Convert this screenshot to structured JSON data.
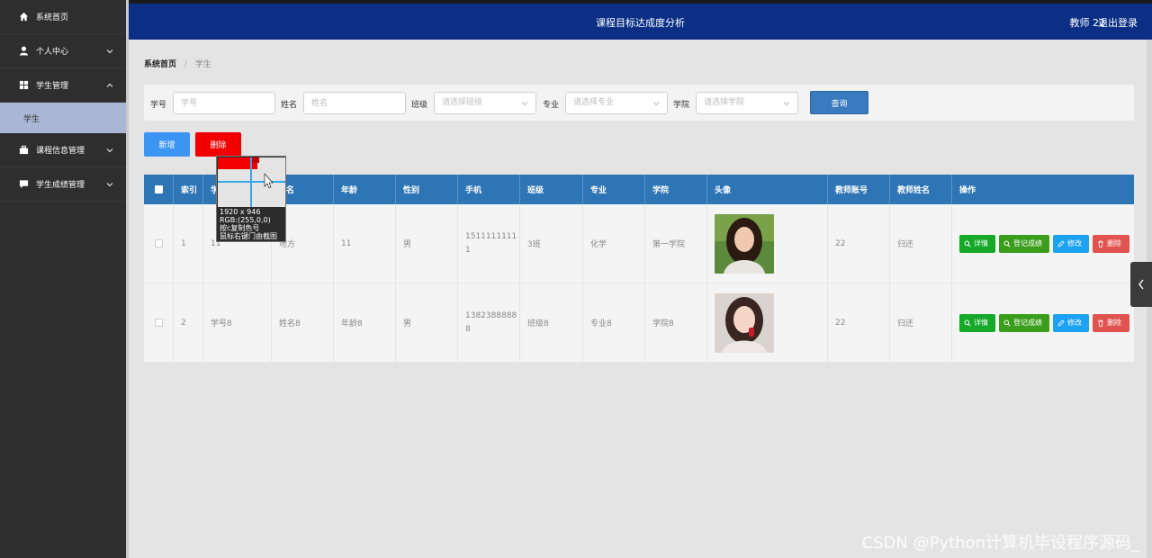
{
  "header": {
    "title": "课程目标达成度分析",
    "user": "教师 22",
    "logout": "退出登录"
  },
  "sidebar": {
    "items": [
      {
        "label": "系统首页",
        "icon": "home-icon"
      },
      {
        "label": "个人中心",
        "icon": "user-icon"
      },
      {
        "label": "学生管理",
        "icon": "grid-icon"
      },
      {
        "label": "学生",
        "sub": true
      },
      {
        "label": "课程信息管理",
        "icon": "briefcase-icon"
      },
      {
        "label": "学生成绩管理",
        "icon": "chat-icon"
      }
    ]
  },
  "breadcrumb": {
    "home": "系统首页",
    "separator": "/",
    "current": "学生"
  },
  "search": {
    "student_no_label": "学号",
    "student_no_placeholder": "学号",
    "name_label": "姓名",
    "name_placeholder": "姓名",
    "class_label": "班级",
    "class_placeholder": "请选择班级",
    "major_label": "专业",
    "major_placeholder": "请选择专业",
    "college_label": "学院",
    "college_placeholder": "请选择学院",
    "query_button": "查询"
  },
  "actions": {
    "add": "新增",
    "delete": "删除"
  },
  "table": {
    "headers": [
      "索引",
      "学号",
      "姓名",
      "年龄",
      "性别",
      "手机",
      "班级",
      "专业",
      "学院",
      "头像",
      "教师账号",
      "教师姓名",
      "操作"
    ],
    "header_visible": {
      "student_no": "学",
      "name": "名"
    },
    "rows": [
      {
        "index": "1",
        "student_no": "11",
        "name": "地方",
        "age": "11",
        "gender": "男",
        "phone": "15111111111",
        "class": "3班",
        "major": "化学",
        "college": "第一学院",
        "teacher_account": "22",
        "teacher_name": "归还"
      },
      {
        "index": "2",
        "student_no": "学号8",
        "name": "姓名8",
        "age": "年龄8",
        "gender": "男",
        "phone": "13823888888",
        "class": "班级8",
        "major": "专业8",
        "college": "学院8",
        "teacher_account": "22",
        "teacher_name": "归还"
      }
    ],
    "row_actions": {
      "detail": "详情",
      "grade": "登记成绩",
      "edit": "修改",
      "delete": "删除"
    }
  },
  "picker_overlay": {
    "size": "1920 x 946",
    "rgb": "RGB:(255,0,0)",
    "hint1": "按c复制色号",
    "hint2": "鼠标右键门由截图"
  },
  "watermark": "CSDN @Python计算机毕设程序源码_",
  "colors": {
    "header": "#0a2f85",
    "sidebar": "#2e2e2e",
    "table_header": "#2e75b6",
    "add_button": "#3d95f3",
    "delete_button": "#f20000"
  }
}
